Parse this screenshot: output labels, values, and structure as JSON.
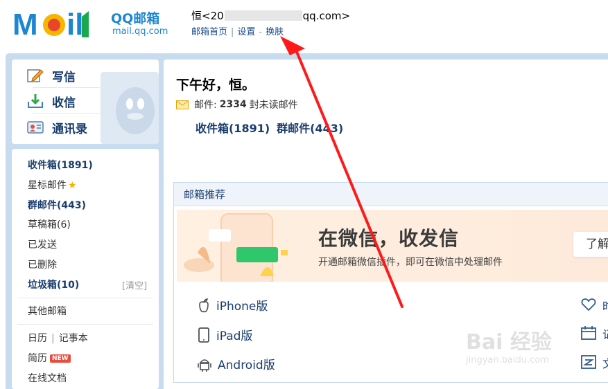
{
  "header": {
    "logo_text": "QQ邮箱",
    "logo_sub": "mail.qq.com",
    "account_prefix": "恒<20",
    "account_suffix": "qq.com>",
    "links": [
      "邮箱首页",
      "设置",
      "换肤"
    ]
  },
  "compose_panel": {
    "items": [
      {
        "label": "写信",
        "icon": "compose-icon"
      },
      {
        "label": "收信",
        "icon": "inbox-download-icon"
      },
      {
        "label": "通讯录",
        "icon": "contacts-icon"
      }
    ]
  },
  "folders": {
    "inbox": "收件箱(1891)",
    "starred": "星标邮件",
    "group": "群邮件(443)",
    "drafts": "草稿箱(6)",
    "sent": "已发送",
    "deleted": "已删除",
    "spam": "垃圾箱(10)",
    "clean": "[清空]",
    "other": "其他邮箱",
    "calendar": "日历",
    "notes": "记事本",
    "resume": "简历",
    "resume_badge": "NEW",
    "docs": "在线文档"
  },
  "main": {
    "greeting": "下午好，恒。",
    "mail_label": "邮件:",
    "mail_count": "2334",
    "mail_unread": "封未读邮件",
    "quick_inbox": "收件箱(1891)",
    "quick_group": "群邮件(443)"
  },
  "recommend": {
    "title": "邮箱推荐",
    "banner_title": "在微信，收发信",
    "banner_desc": "开通邮箱微信插件，即可在微信中处理邮件",
    "banner_button": "了解",
    "apps": [
      {
        "label": "iPhone版",
        "icon": "apple-icon"
      },
      {
        "label": "iPad版",
        "icon": "ipad-icon"
      },
      {
        "label": "Android版",
        "icon": "android-icon"
      }
    ],
    "right_items": [
      {
        "label": "时",
        "icon": "heart-icon"
      },
      {
        "label": "记",
        "icon": "calendar-icon"
      },
      {
        "label": "文",
        "icon": "document-icon"
      }
    ]
  },
  "watermark": {
    "text": "Bai 经验",
    "url": "jingyan.baidu.com"
  },
  "colors": {
    "brand": "#1c86d1",
    "frame": "#c7dcef",
    "link": "#1a4c8c",
    "arrow": "#ff1a1a"
  }
}
